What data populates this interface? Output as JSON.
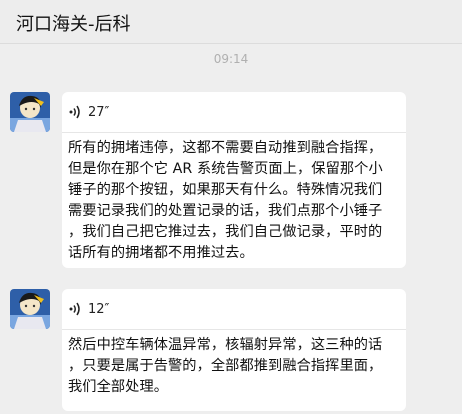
{
  "header": {
    "title": "河口海关-后科"
  },
  "timestamp": "09:14",
  "messages": [
    {
      "duration": "27″",
      "text": "所有的拥堵违停，这都不需要自动推到融合指挥，\n但是你在那个它 AR 系统告警页面上，保留那个小\n锤子的那个按钮，如果那天有什么。特殊情况我们\n需要记录我们的处置记录的话，我们点那个小锤子\n，我们自己把它推过去，我们自己做记录，平时的\n话所有的拥堵都不用推过去。"
    },
    {
      "duration": "12″",
      "text": "然后中控车辆体温异常，核辐射异常，这三种的话\n，只要是属于告警的，全部都推到融合指挥里面，\n我们全部处理。"
    }
  ],
  "colors": {
    "background": "#eeeeee",
    "bubble": "#ffffff",
    "avatar_bg": "#2e5fa8"
  }
}
